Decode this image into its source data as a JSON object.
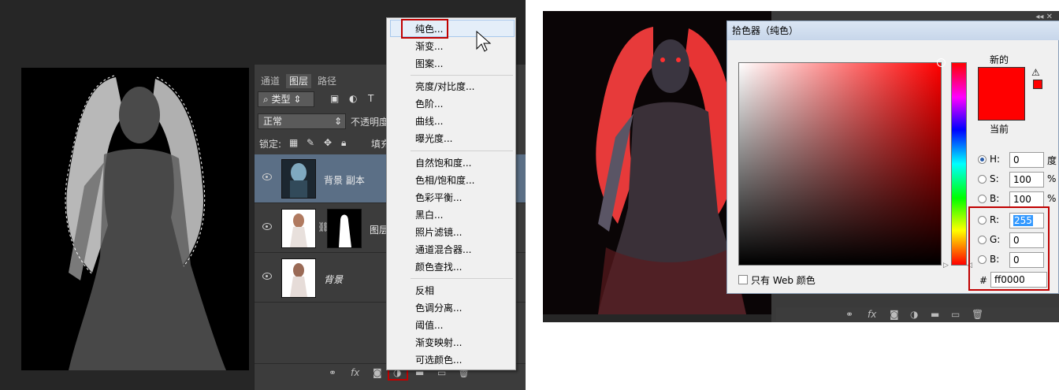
{
  "left": {
    "tabs": [
      "通道",
      "图层",
      "路径"
    ],
    "filter": {
      "label": "类型",
      "search_icon": "search-icon",
      "icons": [
        "image-filter-icon",
        "adjustment-filter-icon",
        "type-filter-icon"
      ],
      "type_icon_glyph": "T"
    },
    "blend_mode": "正常",
    "opacity_label": "不透明度",
    "lock_label": "锁定:",
    "fill_label": "填充",
    "layers": [
      {
        "name": "背景 副本",
        "selected": true
      },
      {
        "name": "图层",
        "selected": false
      },
      {
        "name": "背景",
        "selected": false
      }
    ],
    "bottom_icons": {
      "link": "link-icon",
      "fx": "fx",
      "mask": "mask-icon",
      "adjustment": "adjustment-layer-icon",
      "group": "folder-icon",
      "new": "new-layer-icon",
      "delete": "trash-icon"
    }
  },
  "menu": {
    "items": [
      "纯色...",
      "渐变...",
      "图案...",
      "亮度/对比度...",
      "色阶...",
      "曲线...",
      "曝光度...",
      "自然饱和度...",
      "色相/饱和度...",
      "色彩平衡...",
      "黑白...",
      "照片滤镜...",
      "通道混合器...",
      "颜色查找...",
      "反相",
      "色调分离...",
      "阈值...",
      "渐变映射...",
      "可选颜色..."
    ],
    "highlighted": "纯色..."
  },
  "picker": {
    "title": "拾色器（纯色）",
    "new_label": "新的",
    "current_label": "当前",
    "new_color": "#ff0000",
    "current_color": "#ff0000",
    "hsb": [
      {
        "label": "H:",
        "value": "0",
        "unit": "度",
        "selected": true
      },
      {
        "label": "S:",
        "value": "100",
        "unit": "%"
      },
      {
        "label": "B:",
        "value": "100",
        "unit": "%"
      }
    ],
    "rgb": [
      {
        "label": "R:",
        "value": "255"
      },
      {
        "label": "G:",
        "value": "0"
      },
      {
        "label": "B:",
        "value": "0"
      }
    ],
    "hex_label": "#",
    "hex_value": "ff0000",
    "web_only_label": "只有 Web 颜色",
    "warning_icon": "gamut-warning-icon"
  },
  "colors": {
    "accent_red": "#c00000",
    "selection_blue": "#5b6f86"
  }
}
